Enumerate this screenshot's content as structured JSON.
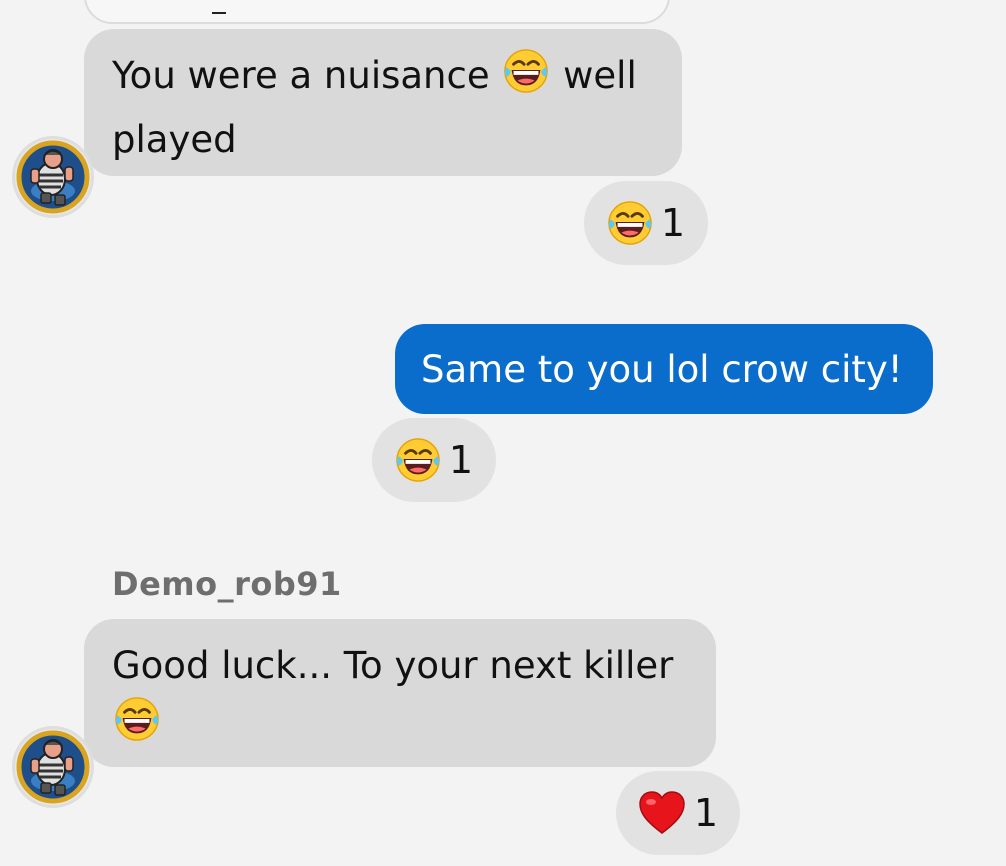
{
  "messages": [
    {
      "direction": "in",
      "text_before": "You were a nuisance",
      "emoji": "face-with-tears-of-joy",
      "text_after": " well played",
      "reaction": {
        "emoji": "face-with-tears-of-joy",
        "count": "1"
      }
    },
    {
      "direction": "out",
      "text": "Same to you lol crow city!",
      "reaction": {
        "emoji": "face-with-tears-of-joy",
        "count": "1"
      }
    },
    {
      "direction": "in",
      "sender": "Demo_rob91",
      "text": "Good luck... To your next killer",
      "emoji": "face-with-tears-of-joy",
      "reaction": {
        "emoji": "red-heart",
        "count": "1"
      }
    }
  ],
  "colors": {
    "background": "#f3f3f3",
    "incoming_bubble": "#d9d9d9",
    "outgoing_bubble": "#0a6ccb",
    "reaction_pill": "#e2e2e2",
    "sender_name": "#6e6e6e"
  }
}
